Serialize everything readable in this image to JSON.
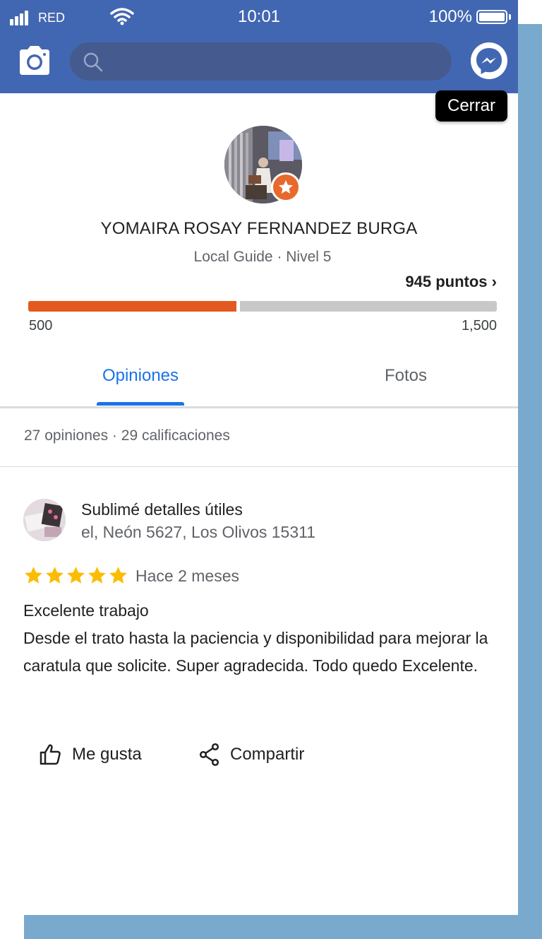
{
  "status_bar": {
    "carrier": "RED",
    "time": "10:01",
    "battery": "100%",
    "battery_level": 1.0
  },
  "nav": {
    "search_placeholder": ""
  },
  "close_label": "Cerrar",
  "profile": {
    "name": "YOMAIRA ROSAY FERNANDEZ BURGA",
    "level": "Local Guide · Nivel 5",
    "points": "945 puntos",
    "points_arrow": "›",
    "progress_min": "500",
    "progress_max": "1,500",
    "progress_fraction": 0.445
  },
  "tabs": [
    {
      "label": "Opiniones",
      "active": true
    },
    {
      "label": "Fotos",
      "active": false
    }
  ],
  "summary": "27 opiniones · 29 calificaciones",
  "review": {
    "place_name": "Sublimé detalles útiles",
    "place_address": "el, Neón 5627, Los Olivos 15311",
    "rating": 5,
    "time": "Hace 2 meses",
    "text": "Excelente trabajo\nDesde el trato hasta la paciencia y disponibilidad para mejorar la caratula que solicite. Super agradecida. Todo quedo Excelente."
  },
  "actions": {
    "like": "Me gusta",
    "share": "Compartir"
  },
  "colors": {
    "facebook_blue": "#4267b2",
    "progress_fill": "#e25a1f",
    "tab_active": "#1a73e8",
    "star": "#fbbc04",
    "badge": "#e8692c"
  }
}
